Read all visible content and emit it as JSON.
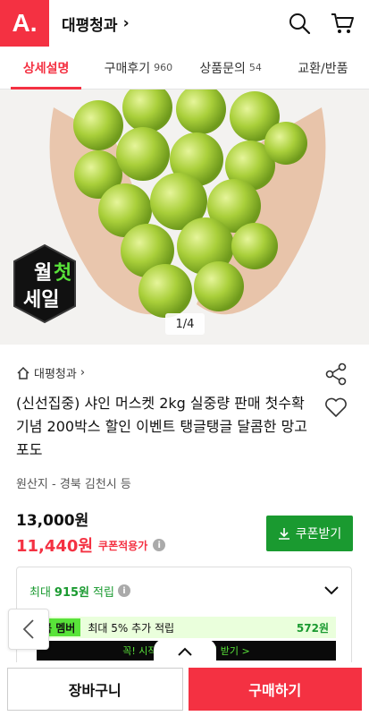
{
  "header": {
    "logo": "A.",
    "store_title": "대평청과",
    "store_chevron": "›",
    "icons": [
      "search-icon",
      "cart-icon"
    ]
  },
  "tabs": [
    {
      "label": "상세설명",
      "count": "",
      "active": true
    },
    {
      "label": "구매후기",
      "count": "960",
      "active": false
    },
    {
      "label": "상품문의",
      "count": "54",
      "active": false
    },
    {
      "label": "교환/반품",
      "count": "",
      "active": false
    }
  ],
  "hero": {
    "pager": "1/4",
    "badge_lines": [
      "월",
      "첫",
      "세일"
    ]
  },
  "product": {
    "store_link": "대평청과",
    "store_link_chevron": "›",
    "title": "(신선집중) 샤인 머스켓 2kg 실중량 판매 첫수확 기념 200박스 할인 이벤트 탱글탱글 달콤한 망고포도",
    "origin": "원산지 - 경북 김천시 등",
    "price_original": "13,000원",
    "price_sale": "11,440원",
    "coupon_note": "쿠폰적용가",
    "coupon_button": "쿠폰받기"
  },
  "points": {
    "prefix": "최대",
    "amount": "915원",
    "suffix": "적립",
    "member_tag_icon": "꼭",
    "member_tag": "멤버",
    "member_text": "최대 5% 추가 적립",
    "member_amount": "572원",
    "banner_text": "꼭! 시작하고 추가 적립 받기 >"
  },
  "bottom": {
    "cart_label": "장바구니",
    "buy_label": "구매하기"
  },
  "colors": {
    "brand_red": "#f43142",
    "green": "#1a9a30",
    "neon_green": "#59e33a"
  }
}
